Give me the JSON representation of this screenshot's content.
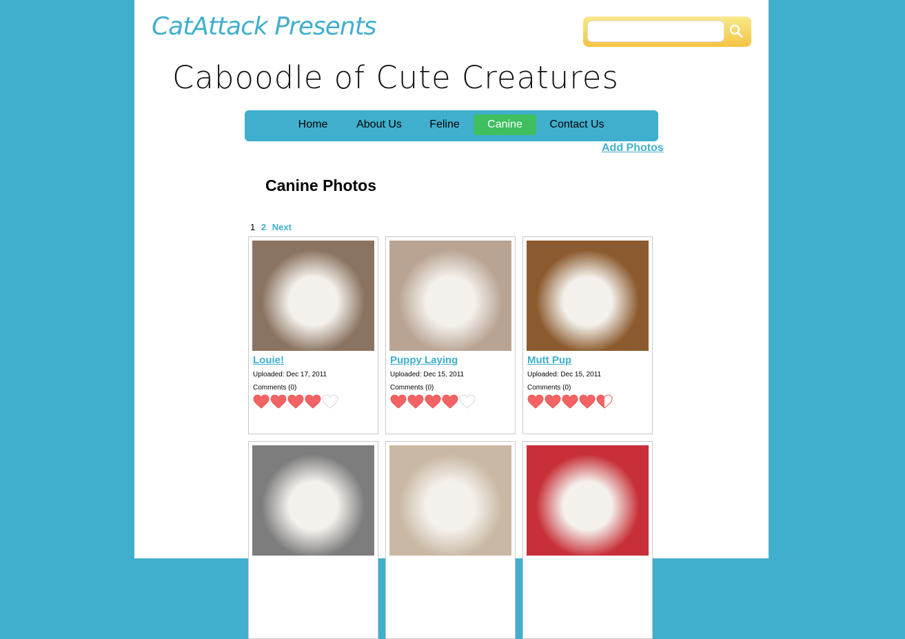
{
  "header": {
    "brand": "CatAttack Presents",
    "site_title": "Caboodle of Cute Creatures"
  },
  "search": {
    "value": "",
    "placeholder": ""
  },
  "nav": {
    "items": [
      {
        "label": "Home"
      },
      {
        "label": "About Us"
      },
      {
        "label": "Feline"
      },
      {
        "label": "Canine",
        "active": true
      },
      {
        "label": "Contact Us"
      }
    ],
    "add_photos": "Add Photos"
  },
  "main": {
    "title": "Canine Photos",
    "pager": {
      "current": "1",
      "page2": "2",
      "next": "Next"
    }
  },
  "cards": [
    {
      "title": "Louie!",
      "uploaded": "Uploaded: Dec 17, 2011",
      "comments": "Comments (0)",
      "rating": 4,
      "thumb_bg": "#8a7361"
    },
    {
      "title": "Puppy Laying",
      "uploaded": "Uploaded: Dec 15, 2011",
      "comments": "Comments (0)",
      "rating": 4,
      "thumb_bg": "#b9a494"
    },
    {
      "title": "Mutt Pup",
      "uploaded": "Uploaded: Dec 15, 2011",
      "comments": "Comments (0)",
      "rating": 4.5,
      "thumb_bg": "#8b5a2e"
    },
    {
      "title": "",
      "uploaded": "",
      "comments": "",
      "rating": 0,
      "thumb_bg": "#7d7d7d"
    },
    {
      "title": "",
      "uploaded": "",
      "comments": "",
      "rating": 0,
      "thumb_bg": "#c9b8a4"
    },
    {
      "title": "",
      "uploaded": "",
      "comments": "",
      "rating": 0,
      "thumb_bg": "#c73038"
    }
  ],
  "colors": {
    "accent": "#40afcd",
    "active_nav": "#3fbf5f",
    "heart": "#f26464",
    "search_frame": "#f5c443"
  }
}
